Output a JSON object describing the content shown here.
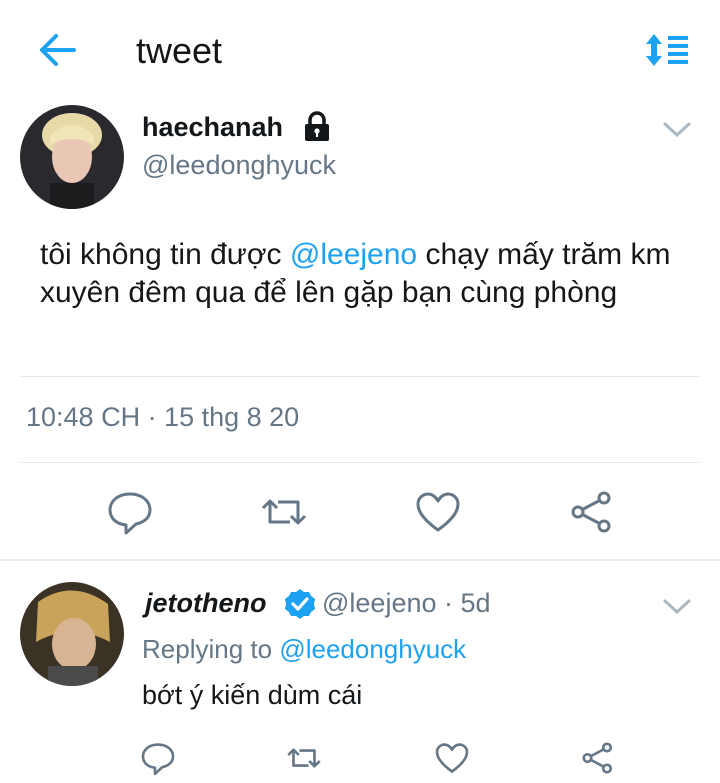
{
  "header": {
    "title": "tweet",
    "back_icon": "arrow-left-icon",
    "sort_icon": "sort-icon",
    "accent": "#1da1f2"
  },
  "main_tweet": {
    "display_name": "haechanah",
    "locked": true,
    "handle": "@leedonghyuck",
    "text_before": "tôi không tin được ",
    "mention": "@leejeno",
    "text_after": " chạy mấy trăm km xuyên đêm qua để lên gặp bạn cùng phòng",
    "timestamp": "10:48 CH · 15 thg 8 20",
    "actions": [
      "reply-icon",
      "retweet-icon",
      "like-icon",
      "share-icon"
    ]
  },
  "reply": {
    "display_name": "jetotheno",
    "verified": true,
    "handle": "@leejeno",
    "time": " · 5d",
    "replying_prefix": "Replying to ",
    "replying_to": "@leedonghyuck",
    "text": "bớt ý kiến dùm cái"
  },
  "colors": {
    "text": "#14171a",
    "secondary": "#657786",
    "divider": "#e1e8ed",
    "icon": "#657786"
  }
}
